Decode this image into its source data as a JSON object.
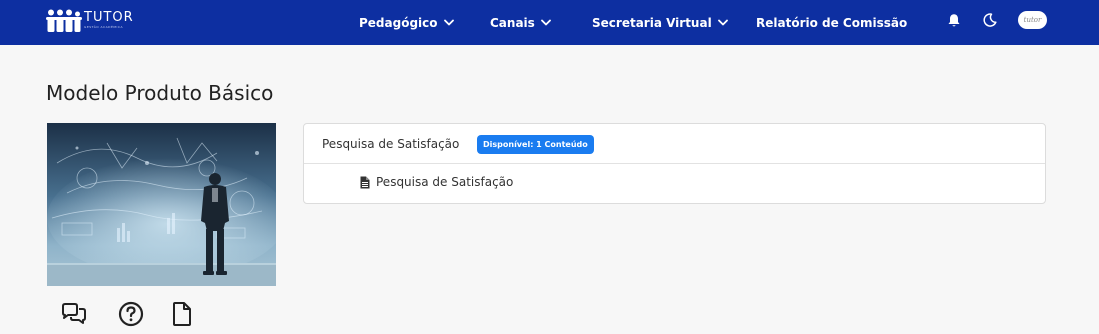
{
  "brand": {
    "name": "TUTOR",
    "tagline": "GESTÃO ACADÊMICA"
  },
  "nav": {
    "items": [
      {
        "label": "Pedagógico",
        "has_dropdown": true
      },
      {
        "label": "Canais",
        "has_dropdown": true
      },
      {
        "label": "Secretaria Virtual",
        "has_dropdown": true
      },
      {
        "label": "Relatório de Comissão",
        "has_dropdown": false
      }
    ],
    "icons": [
      "bell-icon",
      "moon-icon"
    ],
    "avatar_text": "tutor"
  },
  "page": {
    "title": "Modelo Produto Básico"
  },
  "actions": [
    "comments-icon",
    "help-icon",
    "document-icon"
  ],
  "section": {
    "title": "Pesquisa de Satisfação",
    "badge": "Disponível: 1 Conteúdo",
    "items": [
      {
        "label": "Pesquisa de Satisfação",
        "icon": "file-text-icon"
      }
    ]
  },
  "colors": {
    "navbar": "#0d2fa1",
    "badge": "#1a7cf0",
    "background": "#f7f7f7"
  }
}
